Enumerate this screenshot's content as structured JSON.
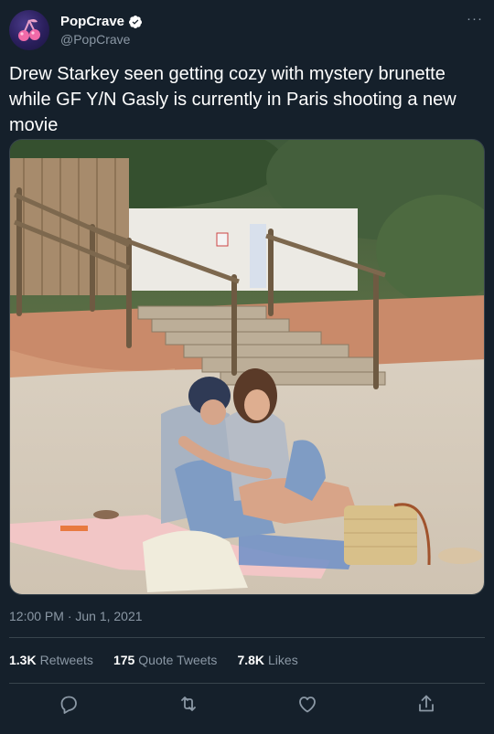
{
  "author": {
    "name": "PopCrave",
    "handle": "@PopCrave",
    "verified": true,
    "avatar_icon": "popcrave-cherry-logo"
  },
  "more_label": "···",
  "tweet": {
    "text": "Drew Starkey seen getting cozy with mystery brunette while GF Y/N Gasly is currently in Paris shooting a new movie",
    "timestamp": "12:00 PM · Jun 1, 2021"
  },
  "stats": {
    "retweets_count": "1.3K",
    "retweets_label": "Retweets",
    "quotes_count": "175",
    "quotes_label": "Quote Tweets",
    "likes_count": "7.8K",
    "likes_label": "Likes"
  },
  "actions": [
    "reply-icon",
    "retweet-icon",
    "like-icon",
    "share-icon"
  ],
  "colors": {
    "background": "#15202b",
    "secondary_text": "#8b98a5",
    "divider": "#38444d",
    "verified_badge": "#ffffff"
  }
}
